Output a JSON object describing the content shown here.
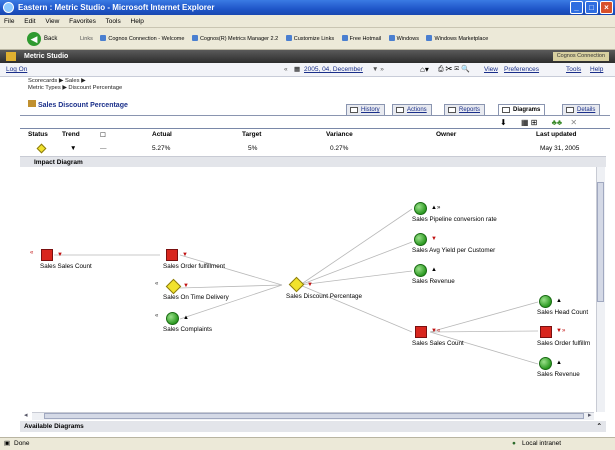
{
  "window": {
    "title": "Eastern : Metric Studio - Microsoft Internet Explorer"
  },
  "menu": [
    "File",
    "Edit",
    "View",
    "Favorites",
    "Tools",
    "Help"
  ],
  "toolbar": {
    "back_label": "Back",
    "links_label": "Links",
    "links": [
      "Cognos Connection - Welcome",
      "Cognos(R) Metrics Manager 2.2",
      "Customize Links",
      "Free Hotmail",
      "Windows",
      "Windows Marketplace"
    ]
  },
  "app": {
    "title": "Metric Studio",
    "cognos_connection": "Cognos Connection"
  },
  "nav": {
    "logon": "Log On",
    "period": "2005, 04, December",
    "view": "View",
    "preferences": "Preferences",
    "tools": "Tools",
    "help": "Help"
  },
  "breadcrumb": {
    "line1": "Scorecards ▶ Sales ▶",
    "line2": "Metric Types ▶ Discount Percentage"
  },
  "metric_title": "Sales Discount Percentage",
  "tabs": [
    "History",
    "Actions",
    "Reports",
    "Diagrams",
    "Details"
  ],
  "columns": {
    "status": "Status",
    "trend": "Trend",
    "actual": "Actual",
    "target": "Target",
    "variance": "Variance",
    "owner": "Owner",
    "last_updated": "Last updated"
  },
  "row": {
    "actual": "5.27%",
    "target": "5%",
    "variance": "0.27%",
    "last_updated": "May 31, 2005",
    "trend": "▼",
    "dash": "—"
  },
  "impact_title": "Impact Diagram",
  "nodes": {
    "sales_count": "Sales Sales Count",
    "order_fulfillment": "Sales Order fulfillment",
    "on_time": "Sales On Time Delivery",
    "complaints": "Sales Complaints",
    "discount": "Sales Discount Percentage",
    "pipeline": "Sales Pipeline conversion rate",
    "avg_yield": "Sales Avg Yield per Customer",
    "revenue": "Sales Revenue",
    "sales_count2": "Sales Sales Count",
    "head_count": "Sales Head Count",
    "order_fulfill2": "Sales Order fulfillm",
    "revenue2": "Sales Revenue"
  },
  "available_title": "Available Diagrams",
  "status": {
    "left": "Done",
    "zone": "Local intranet"
  },
  "colors": {
    "red": "#d8261e",
    "green": "#2c9a22",
    "yellow": "#f1e22c"
  }
}
